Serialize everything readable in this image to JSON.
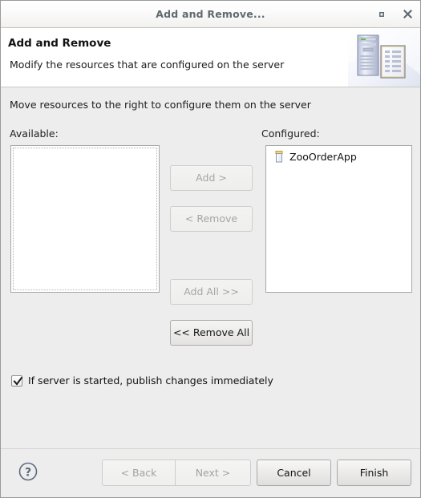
{
  "window": {
    "title": "Add and Remove...",
    "maximize_icon": "maximize-icon",
    "close_icon": "close-icon"
  },
  "header": {
    "title": "Add and Remove",
    "description": "Modify the resources that are configured on the server",
    "art_icon": "server-and-document-icon"
  },
  "body": {
    "instruction": "Move resources to the right to configure them on the server",
    "available": {
      "label": "Available:",
      "items": []
    },
    "configured": {
      "label": "Configured:",
      "items": [
        {
          "name": "ZooOrderApp",
          "icon": "jar-icon"
        }
      ]
    },
    "transfer_buttons": [
      {
        "label": "Add >",
        "enabled": false
      },
      {
        "label": "< Remove",
        "enabled": false
      },
      {
        "label": "Add All >>",
        "enabled": false
      },
      {
        "label": "<< Remove All",
        "enabled": true
      }
    ],
    "publish_checkbox": {
      "label": "If server is started, publish changes immediately",
      "checked": true
    }
  },
  "footer": {
    "help_icon": "help-question-icon",
    "buttons": [
      {
        "label": "< Back",
        "enabled": false
      },
      {
        "label": "Next >",
        "enabled": false
      },
      {
        "label": "Cancel",
        "enabled": true
      },
      {
        "label": "Finish",
        "enabled": true
      }
    ]
  },
  "colors": {
    "window_background": "#ededed",
    "header_background": "#ffffff",
    "title_text": "#60696e",
    "list_background": "#ffffff",
    "jar_lid": "#d9a91e",
    "help_icon": "#5a6b80"
  }
}
